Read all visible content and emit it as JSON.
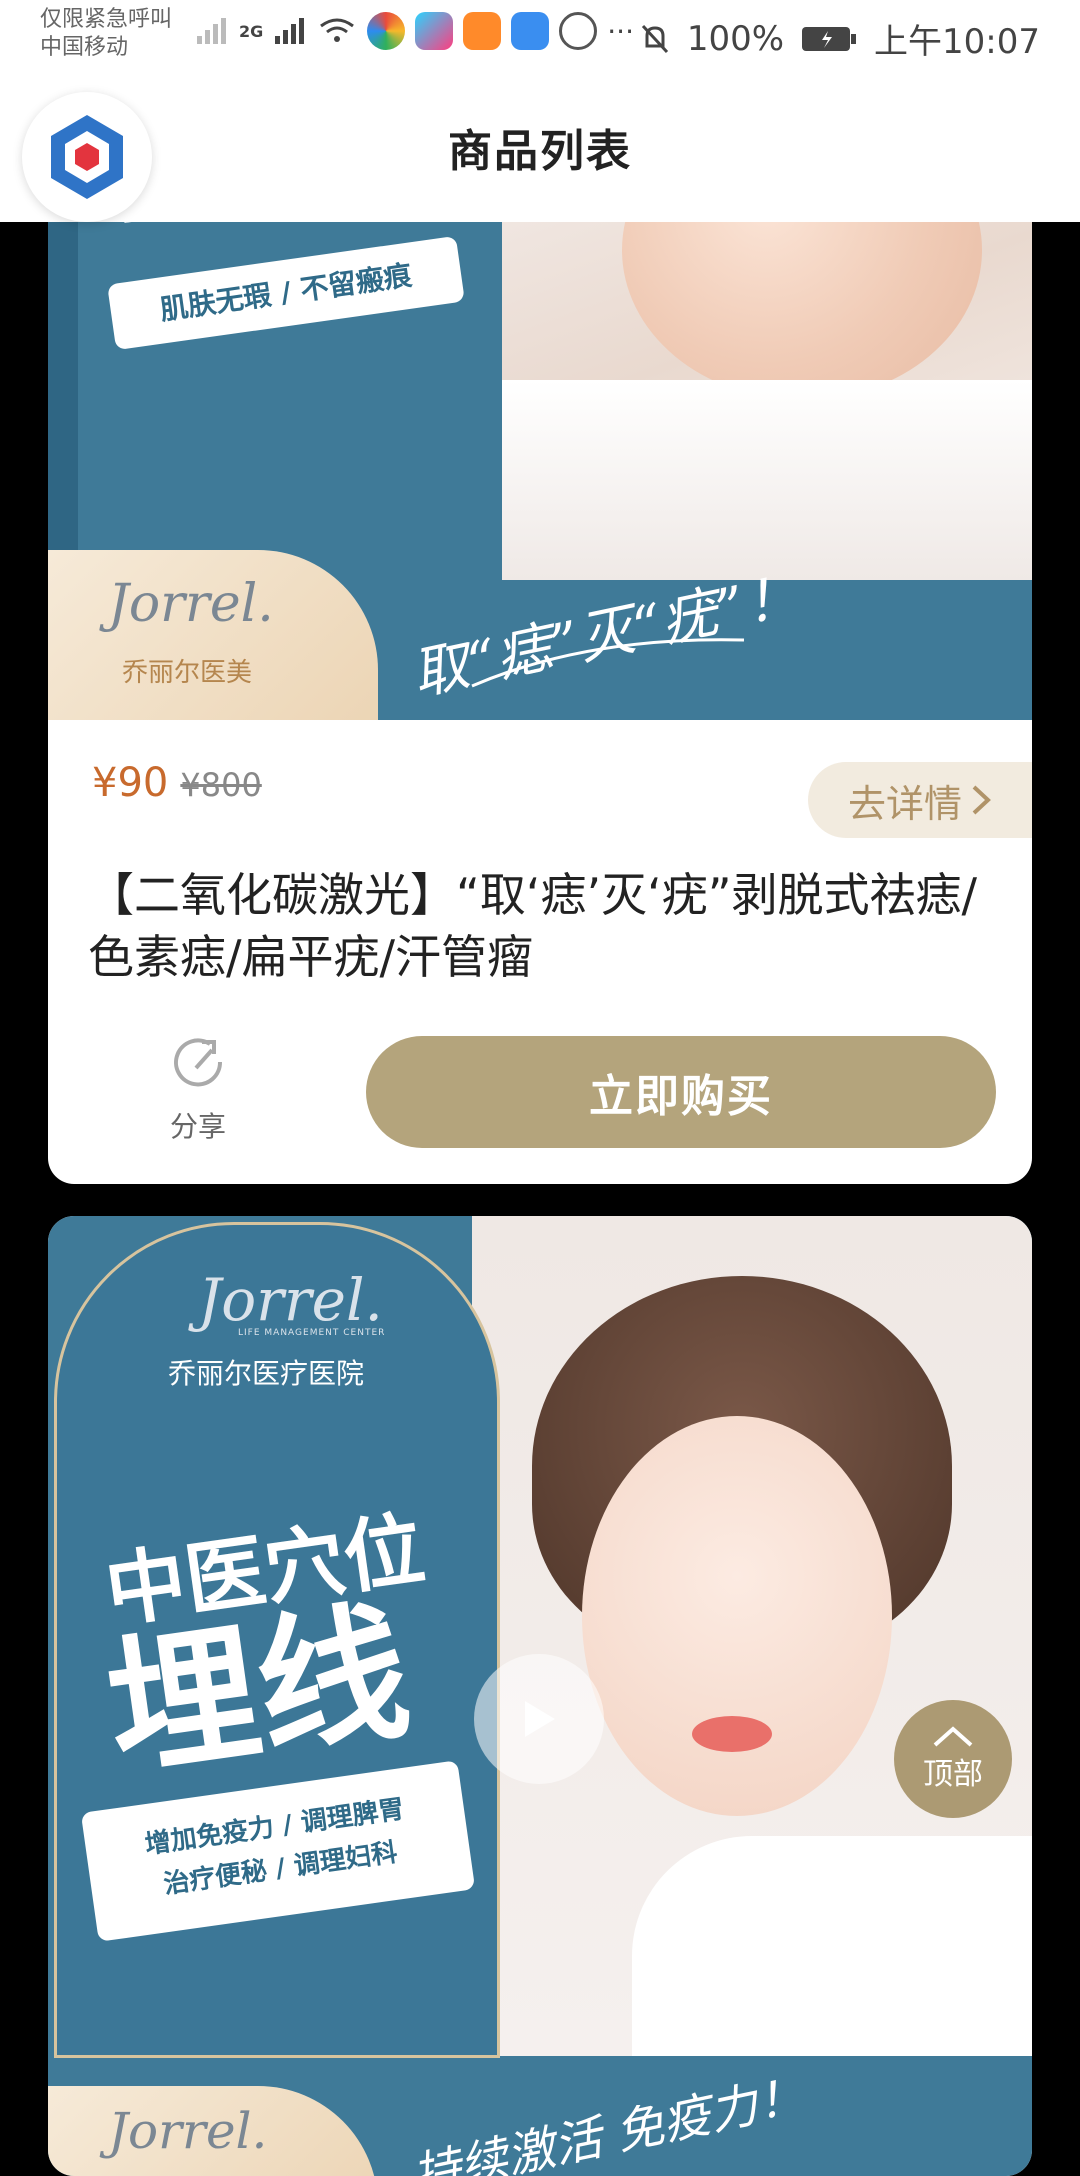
{
  "status_bar": {
    "carrier_line1": "仅限紧急呼叫",
    "carrier_line2": "中国移动",
    "network": "2G",
    "more": "···",
    "battery": "100%",
    "time": "上午10:07"
  },
  "nav": {
    "title": "商品列表"
  },
  "product1": {
    "banner_tag": "肌肤无瑕 / 不留瘢痕",
    "banner_brand_script": "Jorrel.",
    "banner_brand_cn": "乔丽尔医美",
    "banner_slogan": "取“痣”灭“疣”！",
    "price_now": "¥90",
    "price_old": "¥800",
    "detail_label": "去详情",
    "title": "【二氧化碳激光】“取‘痣’灭‘疣”剥脱式祛痣/色素痣/扁平疣/汗管瘤",
    "share_label": "分享",
    "buy_label": "立即购买"
  },
  "product2": {
    "brand_script": "Jorrel.",
    "brand_sub": "LIFE MANAGEMENT CENTER",
    "brand_cn": "乔丽尔医疗医院",
    "headline1": "中医穴位",
    "headline2": "埋线",
    "tag_line1": "增加免疫力 / 调理脾胃",
    "tag_line2": "治疗便秘 / 调理妇科",
    "bottom_brand_script": "Jorrel.",
    "bottom_slogan": "持续激活 免疫力！"
  },
  "fab": {
    "top_label": "顶部"
  },
  "colors": {
    "banner_blue": "#3f7a98",
    "price": "#c86a2d",
    "buy_button": "#b4a47c",
    "detail_bg": "#f2ebdf"
  }
}
